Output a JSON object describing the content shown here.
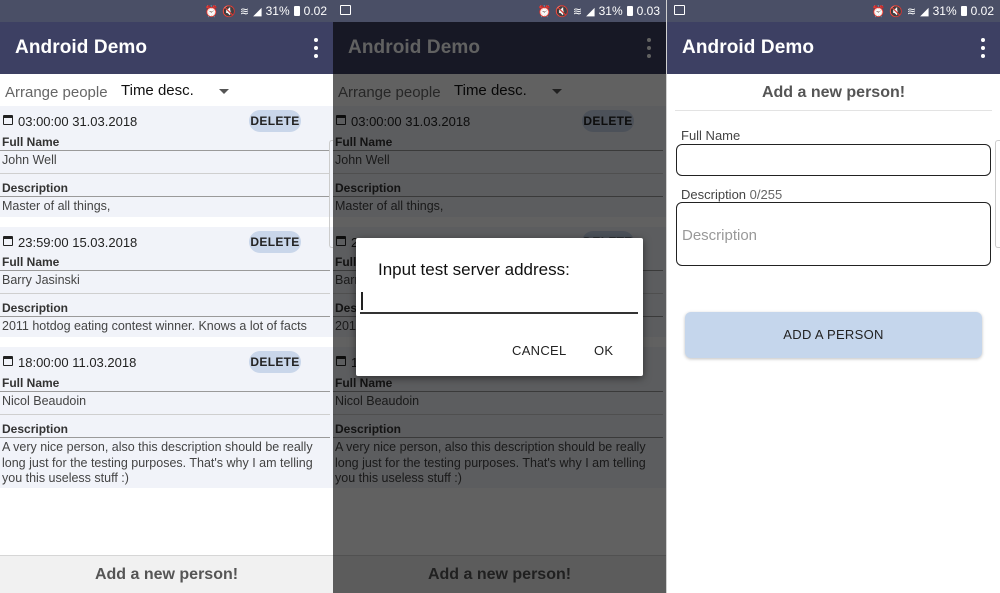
{
  "app_title": "Android Demo",
  "colors": {
    "status_bar": "#4a4f66",
    "app_bar": "#3d4063",
    "card_bg": "#f1f3f9",
    "delete_button": "#c9d6ea",
    "add_button": "#c5d6ec"
  },
  "icons": [
    "image-icon",
    "alarm-icon",
    "mute-icon",
    "wifi-icon",
    "signal-icon",
    "battery-icon",
    "overflow-menu-icon",
    "calendar-icon",
    "dropdown-caret-icon"
  ],
  "screens": [
    {
      "status": {
        "battery": "31%",
        "time": "0.02"
      },
      "sort": {
        "label": "Arrange people",
        "selected": "Time desc."
      },
      "people": [
        {
          "datetime": "03:00:00 31.03.2018",
          "delete_label": "DELETE",
          "name_label": "Full Name",
          "name": "John Well",
          "desc_label": "Description",
          "description": "Master of all things,"
        },
        {
          "datetime": "23:59:00 15.03.2018",
          "delete_label": "DELETE",
          "name_label": "Full Name",
          "name": "Barry Jasinski",
          "desc_label": "Description",
          "description": "2011 hotdog eating contest winner. Knows a lot of facts"
        },
        {
          "datetime": "18:00:00 11.03.2018",
          "delete_label": "DELETE",
          "name_label": "Full Name",
          "name": "Nicol Beaudoin",
          "desc_label": "Description",
          "description": "A very nice person, also this description should be really long just for the testing purposes. That's why I am telling you this useless stuff :)"
        }
      ],
      "footer": "Add a new person!"
    },
    {
      "status": {
        "battery": "31%",
        "time": "0.03"
      },
      "dialog": {
        "title": "Input test server address:",
        "value": "",
        "cancel_label": "CANCEL",
        "ok_label": "OK"
      }
    },
    {
      "status": {
        "battery": "31%",
        "time": "0.02"
      },
      "form": {
        "title": "Add a new person!",
        "name_label": "Full Name",
        "name_value": "",
        "description_label": "Description",
        "description_counter": "0/255",
        "description_placeholder": "Description",
        "submit_label": "ADD A PERSON"
      }
    }
  ]
}
